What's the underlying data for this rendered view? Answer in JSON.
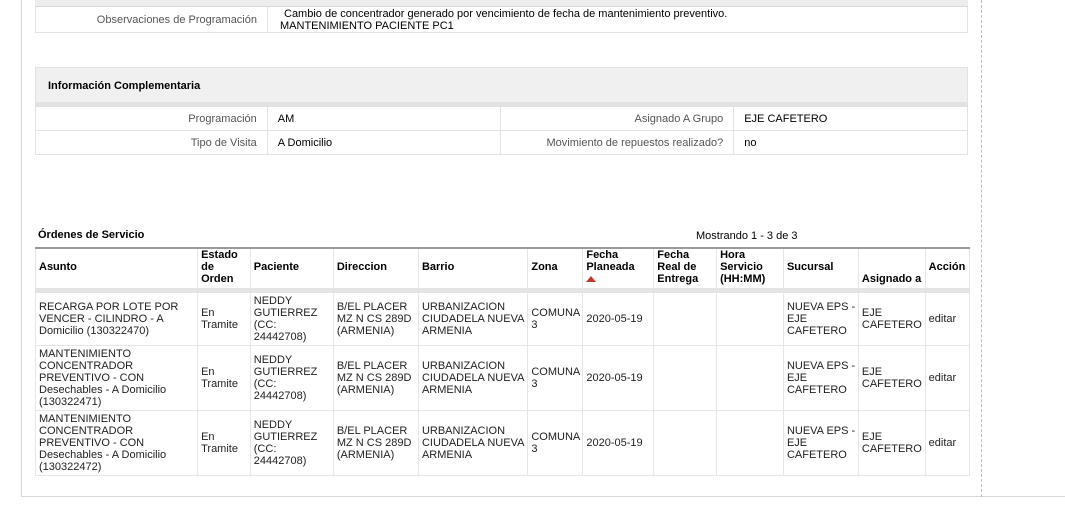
{
  "observaciones": {
    "label": "Observaciones de Programación",
    "line1": "Cambio de concentrador generado por vencimiento de fecha de mantenimiento preventivo.",
    "line2": "MANTENIMIENTO PACIENTE PC1"
  },
  "info_complementaria": {
    "title": "Información Complementaria",
    "programacion_label": "Programación",
    "programacion_value": "AM",
    "asignado_label": "Asignado A Grupo",
    "asignado_value": "EJE CAFETERO",
    "tipo_visita_label": "Tipo de Visita",
    "tipo_visita_value": "A Domicilio",
    "movimiento_label": "Movimiento de repuestos realizado?",
    "movimiento_value": "no"
  },
  "ordenes": {
    "title": "Órdenes de Servicio",
    "showing": "Mostrando 1 - 3 de 3",
    "columns": {
      "asunto": "Asunto",
      "estado": "Estado de Orden",
      "paciente": "Paciente",
      "direccion": "Direccion",
      "barrio": "Barrio",
      "zona": "Zona",
      "fecha_planeada": "Fecha Planeada",
      "fecha_real": "Fecha Real de Entrega",
      "hora": "Hora Servicio (HH:MM)",
      "sucursal": "Sucursal",
      "asignado": "Asignado a",
      "accion": "Acción"
    },
    "rows": [
      {
        "asunto": "RECARGA POR LOTE POR VENCER - CILINDRO - A Domicilio (130322470)",
        "estado": "En Tramite",
        "paciente": "NEDDY GUTIERREZ (CC: 24442708)",
        "direccion": "B/EL PLACER MZ N CS 289D (ARMENIA)",
        "barrio": "URBANIZACION CIUDADELA NUEVA ARMENIA",
        "zona": "COMUNA 3",
        "fecha_planeada": "2020-05-19",
        "fecha_real": "",
        "hora": "",
        "sucursal": "NUEVA EPS - EJE CAFETERO",
        "asignado": "EJE CAFETERO",
        "accion": "editar"
      },
      {
        "asunto": "MANTENIMIENTO CONCENTRADOR PREVENTIVO - CON Desechables - A Domicilio (130322471)",
        "estado": "En Tramite",
        "paciente": "NEDDY GUTIERREZ (CC: 24442708)",
        "direccion": "B/EL PLACER MZ N CS 289D (ARMENIA)",
        "barrio": "URBANIZACION CIUDADELA NUEVA ARMENIA",
        "zona": "COMUNA 3",
        "fecha_planeada": "2020-05-19",
        "fecha_real": "",
        "hora": "",
        "sucursal": "NUEVA EPS - EJE CAFETERO",
        "asignado": "EJE CAFETERO",
        "accion": "editar"
      },
      {
        "asunto": "MANTENIMIENTO CONCENTRADOR PREVENTIVO - CON Desechables - A Domicilio (130322472)",
        "estado": "En Tramite",
        "paciente": "NEDDY GUTIERREZ (CC: 24442708)",
        "direccion": "B/EL PLACER MZ N CS 289D (ARMENIA)",
        "barrio": "URBANIZACION CIUDADELA NUEVA ARMENIA",
        "zona": "COMUNA 3",
        "fecha_planeada": "2020-05-19",
        "fecha_real": "",
        "hora": "",
        "sucursal": "NUEVA EPS - EJE CAFETERO",
        "asignado": "EJE CAFETERO",
        "accion": "editar"
      }
    ]
  }
}
